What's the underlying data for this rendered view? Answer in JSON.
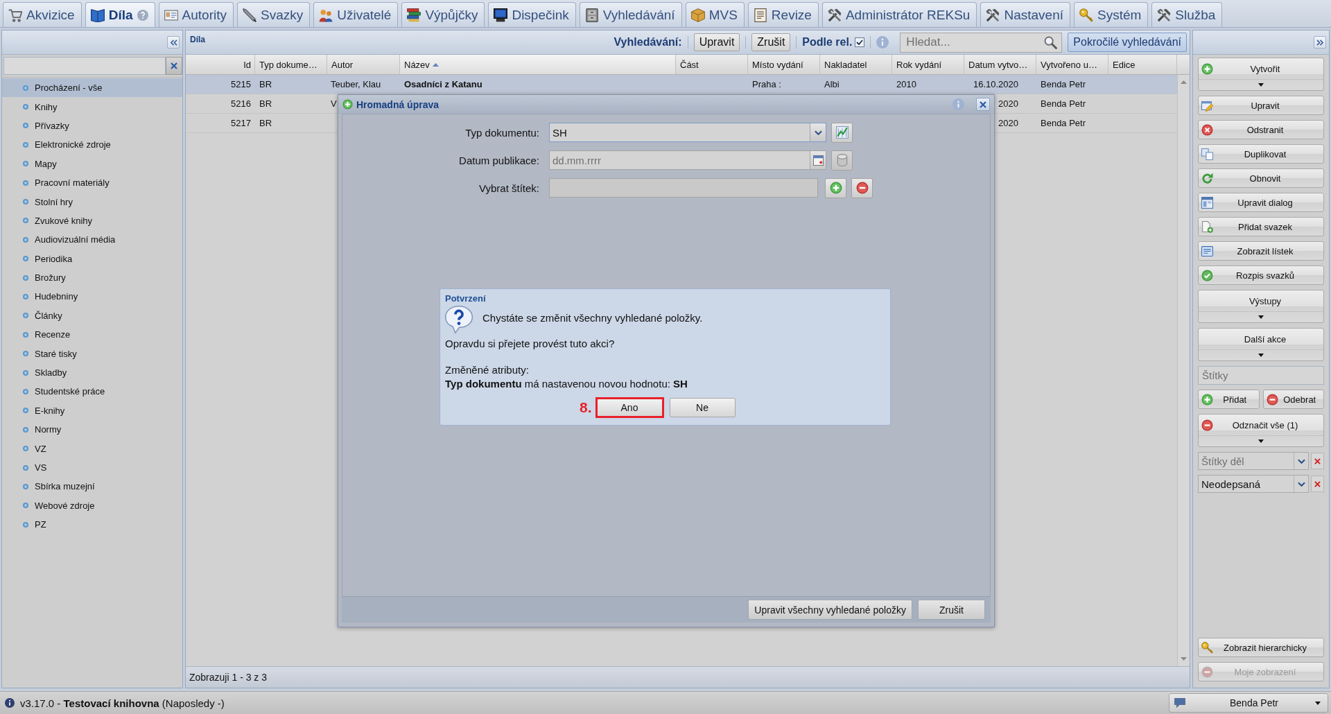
{
  "tabs": [
    {
      "label": "Akvizice",
      "selected": false
    },
    {
      "label": "Díla",
      "selected": true
    },
    {
      "label": "Autority",
      "selected": false
    },
    {
      "label": "Svazky",
      "selected": false
    },
    {
      "label": "Uživatelé",
      "selected": false
    },
    {
      "label": "Výpůjčky",
      "selected": false
    },
    {
      "label": "Dispečink",
      "selected": false
    },
    {
      "label": "Vyhledávání",
      "selected": false
    },
    {
      "label": "MVS",
      "selected": false
    },
    {
      "label": "Revize",
      "selected": false
    },
    {
      "label": "Administrátor REKSu",
      "selected": false
    },
    {
      "label": "Nastavení",
      "selected": false
    },
    {
      "label": "Systém",
      "selected": false
    },
    {
      "label": "Služba",
      "selected": false
    }
  ],
  "sidebar": {
    "items": [
      {
        "label": "Procházení - vše",
        "selected": true
      },
      {
        "label": "Knihy",
        "selected": false
      },
      {
        "label": "Přívazky",
        "selected": false
      },
      {
        "label": "Elektronické zdroje",
        "selected": false
      },
      {
        "label": "Mapy",
        "selected": false
      },
      {
        "label": "Pracovní materiály",
        "selected": false
      },
      {
        "label": "Stolní hry",
        "selected": false
      },
      {
        "label": "Zvukové knihy",
        "selected": false
      },
      {
        "label": "Audiovizuální média",
        "selected": false
      },
      {
        "label": "Periodika",
        "selected": false
      },
      {
        "label": "Brožury",
        "selected": false
      },
      {
        "label": "Hudebniny",
        "selected": false
      },
      {
        "label": "Články",
        "selected": false
      },
      {
        "label": "Recenze",
        "selected": false
      },
      {
        "label": "Staré tisky",
        "selected": false
      },
      {
        "label": "Skladby",
        "selected": false
      },
      {
        "label": "Studentské práce",
        "selected": false
      },
      {
        "label": "E-knihy",
        "selected": false
      },
      {
        "label": "Normy",
        "selected": false
      },
      {
        "label": "VZ",
        "selected": false
      },
      {
        "label": "VS",
        "selected": false
      },
      {
        "label": "Sbírka muzejní",
        "selected": false
      },
      {
        "label": "Webové zdroje",
        "selected": false
      },
      {
        "label": "PZ",
        "selected": false
      }
    ]
  },
  "main": {
    "title": "Díla",
    "search_bar": {
      "label": "Vyhledávání:",
      "buttons": [
        "Upravit",
        "Zrušit"
      ],
      "relevance": {
        "label": "Podle rel.",
        "checked": true
      },
      "search": {
        "placeholder": "Hledat..."
      },
      "advanced": {
        "label": "Pokročilé vyhledávání",
        "pressed": true
      }
    },
    "table": {
      "columns": [
        {
          "label": "Id",
          "sorted": false
        },
        {
          "label": "Typ dokume…",
          "sorted": false
        },
        {
          "label": "Autor",
          "sorted": false
        },
        {
          "label": "Název",
          "sorted": true
        },
        {
          "label": "Část",
          "sorted": false
        },
        {
          "label": "Místo vydání",
          "sorted": false
        },
        {
          "label": "Nakladatel",
          "sorted": false
        },
        {
          "label": "Rok vydání",
          "sorted": false
        },
        {
          "label": "Datum vytvo…",
          "sorted": false
        },
        {
          "label": "Vytvořeno u…",
          "sorted": false
        },
        {
          "label": "Edice",
          "sorted": false
        }
      ],
      "rows": [
        {
          "selected": true,
          "cells": {
            "id": "5215",
            "type": "BR",
            "author": "Teuber, Klau",
            "title": "Osadníci z Katanu",
            "place": "Praha :",
            "publisher": "Albi",
            "year": "2010",
            "created": "16.10.2020",
            "created_by": "Benda Petr"
          }
        },
        {
          "selected": false,
          "cells": {
            "id": "5216",
            "type": "BR",
            "author": "V",
            "created": "2020",
            "created_by": "Benda Petr"
          }
        },
        {
          "selected": false,
          "cells": {
            "id": "5217",
            "type": "BR",
            "created": "2020",
            "created_by": "Benda Petr"
          }
        }
      ]
    },
    "footer": "Zobrazuji 1 - 3 z 3"
  },
  "dialog": {
    "title": "Hromadná úprava",
    "fields": [
      {
        "kind": "select",
        "label": "Typ dokumentu:",
        "value": "SH"
      },
      {
        "kind": "date",
        "label": "Datum publikace:",
        "placeholder": "dd.mm.rrrr"
      },
      {
        "kind": "tags",
        "label": "Vybrat štítek:"
      }
    ],
    "buttons": [
      "Upravit všechny vyhledané položky",
      "Zrušit"
    ],
    "confirm": {
      "title": "Potvrzení",
      "message": "Chystáte se změnit všechny vyhledané položky.",
      "question": "Opravdu si přejete provést tuto akci?",
      "changes_label": "Změněné atributy:",
      "change": "**Typ dokumentu** má nastavenou novou hodnotu: **SH**",
      "buttons": [
        {
          "label": "Ano",
          "highlighted": true,
          "step": "8."
        },
        {
          "label": "Ne",
          "highlighted": false
        }
      ]
    }
  },
  "right_panel": {
    "actions": [
      {
        "kind": "menu",
        "label": "Vytvořit"
      },
      {
        "kind": "button",
        "label": "Upravit"
      },
      {
        "kind": "button",
        "label": "Odstranit"
      },
      {
        "kind": "button",
        "label": "Duplikovat"
      },
      {
        "kind": "button",
        "label": "Obnovit"
      },
      {
        "kind": "button",
        "label": "Upravit dialog"
      },
      {
        "kind": "button",
        "label": "Přidat svazek"
      },
      {
        "kind": "button",
        "label": "Zobrazit lístek"
      },
      {
        "kind": "button",
        "label": "Rozpis svazků"
      },
      {
        "kind": "menu",
        "label": "Výstupy"
      },
      {
        "kind": "menu",
        "label": "Další akce"
      }
    ],
    "tags": {
      "placeholder": "Štítky",
      "buttons": [
        "Přidat",
        "Odebrat"
      ],
      "unmark": "Odznačit vše (1)",
      "filters": [
        {
          "placeholder": "Štítky děl"
        },
        {
          "value": "Neodepsaná"
        }
      ]
    },
    "bottom_actions": [
      {
        "label": "Zobrazit hierarchicky",
        "disabled": false
      },
      {
        "label": "Moje zobrazení",
        "disabled": true
      }
    ]
  },
  "status_bar": {
    "text": "v3.17.0 - **Testovací knihovna** (Naposledy -)",
    "user": "Benda Petr"
  }
}
